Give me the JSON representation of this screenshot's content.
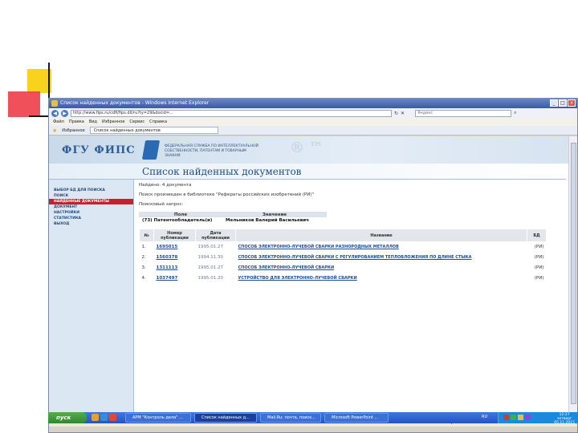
{
  "window": {
    "title": "Список найденных документов - Windows Internet Explorer",
    "controls": [
      "_",
      "□",
      "×"
    ]
  },
  "address": {
    "url": "http://www.fips.ru/cdfi/fips.dll/ru?ty=29&docid=...",
    "search_placeholder": "Яндекс"
  },
  "menu": [
    "Файл",
    "Правка",
    "Вид",
    "Избранное",
    "Сервис",
    "Справка"
  ],
  "favorites": {
    "label": "Избранное",
    "tab": "Список найденных документов"
  },
  "header": {
    "logo": "ФГУ ФИПС",
    "agency": "ФЕДЕРАЛЬНАЯ СЛУЖБА ПО ИНТЕЛЛЕКТУАЛЬНОЙ СОБСТВЕННОСТИ, ПАТЕНТАМ И ТОВАРНЫМ ЗНАКАМ",
    "watermark": "® ™"
  },
  "sidebar": {
    "items": [
      {
        "label": "ВЫБОР БД ДЛЯ ПОИСКА",
        "active": false
      },
      {
        "label": "ПОИСК",
        "active": false
      },
      {
        "label": "НАЙДЕННЫЕ ДОКУМЕНТЫ",
        "active": true
      },
      {
        "label": "ДОКУМЕНТ",
        "active": false
      },
      {
        "label": "НАСТРОЙКИ",
        "active": false
      },
      {
        "label": "СТАТИСТИКА",
        "active": false
      },
      {
        "label": "ВЫХОД",
        "active": false
      }
    ]
  },
  "main": {
    "title": "Список найденных документов",
    "found": "Найдено: 4 документа",
    "searched_in": "Поиск произведен в библиотеке \"Рефераты российских изобретений (РИ)\"",
    "query_label": "Поисковый запрос:",
    "query": {
      "headers": [
        "Поле",
        "Значение"
      ],
      "field": "(73) Патентообладатель(и)",
      "value": "Мельников Валерий Васильевич"
    },
    "results": {
      "headers": [
        "№",
        "Номер публикации",
        "Дата публикации",
        "Название",
        "БД"
      ],
      "rows": [
        {
          "n": "1.",
          "pub": "1695015",
          "date": "1995.01.27",
          "name": "СПОСОБ ЭЛЕКТРОННО-ЛУЧЕВОЙ СВАРКИ РАЗНОРОДНЫХ МЕТАЛЛОВ",
          "db": "(РИ)"
        },
        {
          "n": "2.",
          "pub": "1560378",
          "date": "1994.11.30",
          "name": "СПОСОБ ЭЛЕКТРОННО-ЛУЧЕВОЙ СВАРКИ С РЕГУЛИРОВАНИЕМ ТЕПЛОВЛОЖЕНИЯ ПО ДЛИНЕ СТЫКА",
          "db": "(РИ)"
        },
        {
          "n": "3.",
          "pub": "1311113",
          "date": "1995.01.27",
          "name": "СПОСОБ ЭЛЕКТРОННО-ЛУЧЕВОЙ СВАРКИ",
          "db": "(РИ)"
        },
        {
          "n": "4.",
          "pub": "1037497",
          "date": "1995.01.20",
          "name": "УСТРОЙСТВО ДЛЯ ЭЛЕКТРОННО-ЛУЧЕВОЙ СВАРКИ",
          "db": "(РИ)"
        }
      ]
    }
  },
  "status": {
    "zone": "Интернет",
    "zoom": "100%"
  },
  "taskbar": {
    "start": "пуск",
    "tasks": [
      {
        "label": "АРМ \"Контроль дела\" ...",
        "active": false
      },
      {
        "label": "Список найденных д...",
        "active": true
      },
      {
        "label": "Mail.Ru: почта, поиск...",
        "active": false
      },
      {
        "label": "Microsoft PowerPoint ...",
        "active": false
      }
    ],
    "lang": "RU",
    "time": "12:27",
    "weekday": "четверг",
    "date": "05.11.2015"
  }
}
